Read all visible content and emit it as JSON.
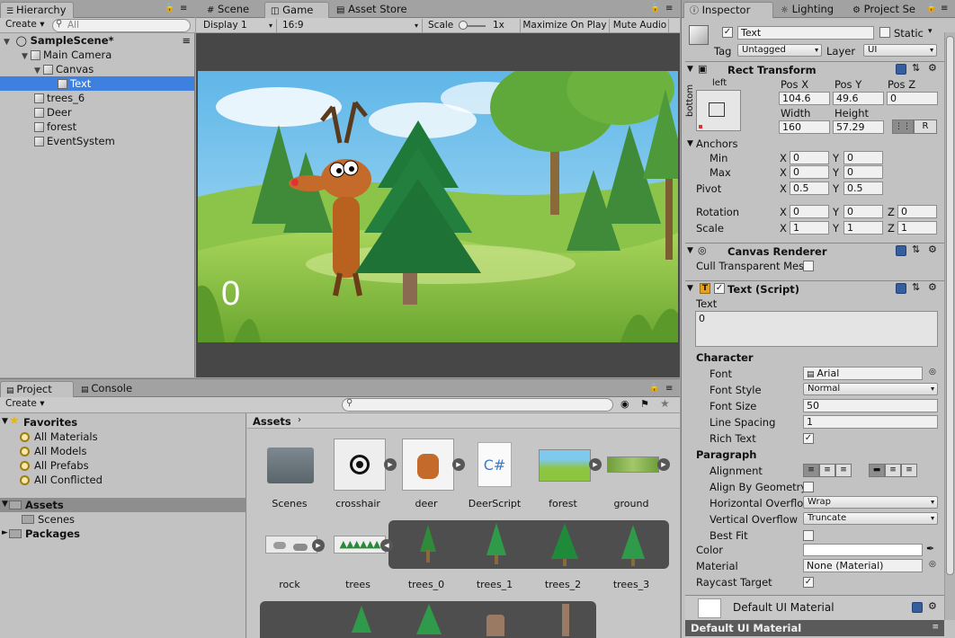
{
  "hierarchy": {
    "tab": "Hierarchy",
    "create": "Create",
    "search_placeholder": "All",
    "scene": "SampleScene*",
    "items": [
      {
        "label": "Main Camera"
      },
      {
        "label": "Canvas"
      },
      {
        "label": "Text"
      },
      {
        "label": "trees_6"
      },
      {
        "label": "Deer"
      },
      {
        "label": "forest"
      },
      {
        "label": "EventSystem"
      }
    ]
  },
  "center_tabs": {
    "scene": "Scene",
    "game": "Game",
    "asset_store": "Asset Store"
  },
  "game_toolbar": {
    "display": "Display 1",
    "aspect": "16:9",
    "scale_label": "Scale",
    "scale_value": "1x",
    "maximize": "Maximize On Play",
    "mute": "Mute Audio"
  },
  "game_view": {
    "score_text": "0"
  },
  "right_tabs": {
    "inspector": "Inspector",
    "lighting": "Lighting",
    "project_settings": "Project Se"
  },
  "inspector": {
    "object_name": "Text",
    "static_label": "Static",
    "tag_label": "Tag",
    "tag_value": "Untagged",
    "layer_label": "Layer",
    "layer_value": "UI",
    "rect_transform": {
      "title": "Rect Transform",
      "anchor_h": "left",
      "anchor_v": "bottom",
      "pos_x_label": "Pos X",
      "pos_y_label": "Pos Y",
      "pos_z_label": "Pos Z",
      "pos_x": "104.6",
      "pos_y": "49.6",
      "pos_z": "0",
      "width_label": "Width",
      "height_label": "Height",
      "width": "160",
      "height": "57.29",
      "r_button": "R",
      "anchors_label": "Anchors",
      "min_label": "Min",
      "max_label": "Max",
      "min_x": "0",
      "min_y": "0",
      "max_x": "0",
      "max_y": "0",
      "pivot_label": "Pivot",
      "pivot_x": "0.5",
      "pivot_y": "0.5",
      "rotation_label": "Rotation",
      "rot_x": "0",
      "rot_y": "0",
      "rot_z": "0",
      "scale_label": "Scale",
      "scale_x": "1",
      "scale_y": "1",
      "scale_z": "1",
      "x": "X",
      "y": "Y",
      "z": "Z"
    },
    "canvas_renderer": {
      "title": "Canvas Renderer",
      "cull_label": "Cull Transparent Mes"
    },
    "text_script": {
      "title": "Text (Script)",
      "text_label": "Text",
      "text_value": "0",
      "character_header": "Character",
      "font_label": "Font",
      "font_value": "Arial",
      "font_style_label": "Font Style",
      "font_style_value": "Normal",
      "font_size_label": "Font Size",
      "font_size_value": "50",
      "line_spacing_label": "Line Spacing",
      "line_spacing_value": "1",
      "rich_text_label": "Rich Text",
      "paragraph_header": "Paragraph",
      "alignment_label": "Alignment",
      "align_geometry_label": "Align By Geometry",
      "h_overflow_label": "Horizontal Overflo",
      "h_overflow_value": "Wrap",
      "v_overflow_label": "Vertical Overflow",
      "v_overflow_value": "Truncate",
      "best_fit_label": "Best Fit",
      "color_label": "Color",
      "material_label": "Material",
      "material_value": "None (Material)",
      "raycast_label": "Raycast Target"
    },
    "default_material": "Default UI Material",
    "bottom_bar": "Default UI Material"
  },
  "project": {
    "tab_project": "Project",
    "tab_console": "Console",
    "create": "Create",
    "favorites_label": "Favorites",
    "favorites": [
      "All Materials",
      "All Models",
      "All Prefabs",
      "All Conflicted"
    ],
    "assets_label": "Assets",
    "scenes_label": "Scenes",
    "packages_label": "Packages",
    "breadcrumb": "Assets",
    "assets": [
      "Scenes",
      "crosshair",
      "deer",
      "DeerScript",
      "forest",
      "ground",
      "rock",
      "trees",
      "trees_0",
      "trees_1",
      "trees_2",
      "trees_3"
    ],
    "script_glyph": "C#"
  },
  "colors": {
    "selection": "#3d80df",
    "panel": "#c2c2c2",
    "sky": "#79c6ee",
    "grass": "#8dc540"
  }
}
